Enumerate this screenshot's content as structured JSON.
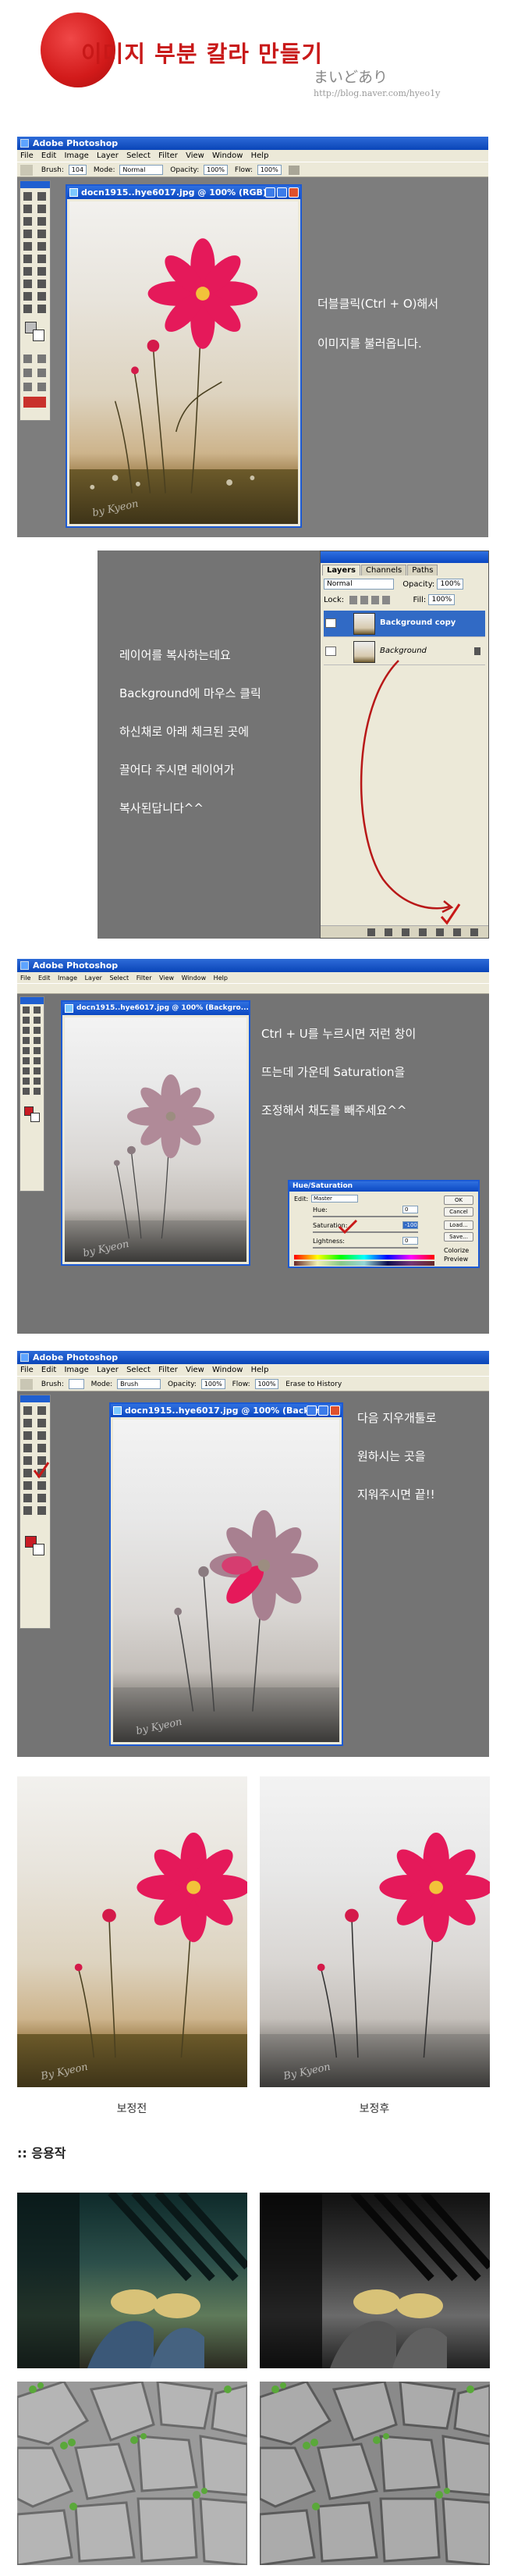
{
  "header": {
    "title": "이미지 부분 칼라 만들기",
    "author": "まいどあり",
    "url": "http://blog.naver.com/hyeo1y"
  },
  "step1": {
    "app_title": "Adobe Photoshop",
    "menu": [
      "File",
      "Edit",
      "Image",
      "Layer",
      "Select",
      "Filter",
      "View",
      "Window",
      "Help"
    ],
    "options": {
      "brush_label": "Brush:",
      "brush_size": "104",
      "mode_label": "Mode:",
      "mode_value": "Normal",
      "opacity_label": "Opacity:",
      "opacity_value": "100%",
      "flow_label": "Flow:",
      "flow_value": "100%"
    },
    "doc_title": "docn1915..hye6017.jpg @ 100% (RGB)",
    "note_lines": [
      "더블클릭(Ctrl + O)해서",
      "이미지를 불러옵니다."
    ]
  },
  "step2": {
    "panel_tabs": [
      "Layers",
      "Channels",
      "Paths"
    ],
    "blend_mode": "Normal",
    "opacity_label": "Opacity:",
    "opacity_value": "100%",
    "lock_label": "Lock:",
    "fill_label": "Fill:",
    "fill_value": "100%",
    "layers": [
      "Background copy",
      "Background"
    ],
    "note_lines": [
      "레이어를 복사하는데요",
      "Background에 마우스 클릭",
      "하신채로 아래 체크된 곳에",
      "끌어다 주시면 레이어가",
      "복사된답니다^^"
    ]
  },
  "step3": {
    "app_title": "Adobe Photoshop",
    "doc_title": "docn1915..hye6017.jpg @ 100% (Backgro...",
    "note_lines": [
      "Ctrl + U를 누르시면 저런 창이",
      "뜨는데 가운데 Saturation을",
      "조정해서 채도를 빼주세요^^"
    ],
    "dialog": {
      "title": "Hue/Saturation",
      "edit_label": "Edit:",
      "edit_value": "Master",
      "hue_label": "Hue:",
      "hue_value": "0",
      "sat_label": "Saturation:",
      "sat_value": "-100",
      "light_label": "Lightness:",
      "light_value": "0",
      "buttons": [
        "OK",
        "Cancel",
        "Load...",
        "Save..."
      ],
      "colorize": "Colorize",
      "preview": "Preview"
    }
  },
  "step4": {
    "app_title": "Adobe Photoshop",
    "menu": [
      "File",
      "Edit",
      "Image",
      "Layer",
      "Select",
      "Filter",
      "View",
      "Window",
      "Help"
    ],
    "options": {
      "brush_label": "Brush:",
      "mode_label": "Mode:",
      "mode_value": "Brush",
      "opacity_label": "Opacity:",
      "opacity_value": "100%",
      "flow_label": "Flow:",
      "flow_value": "100%",
      "history_label": "Erase to History"
    },
    "doc_title": "docn1915..hye6017.jpg @ 100% (Backgro...",
    "note_lines": [
      "다음 지우개툴로",
      "원하시는 곳을",
      "지워주시면 끝!!"
    ]
  },
  "compare": {
    "before_label": "보정전",
    "after_label": "보정후"
  },
  "examples": {
    "heading": ":: 응용작"
  },
  "colors": {
    "accent_red": "#d21a1a",
    "card_gray": "#747474",
    "flower_pink": "#e5195a"
  }
}
